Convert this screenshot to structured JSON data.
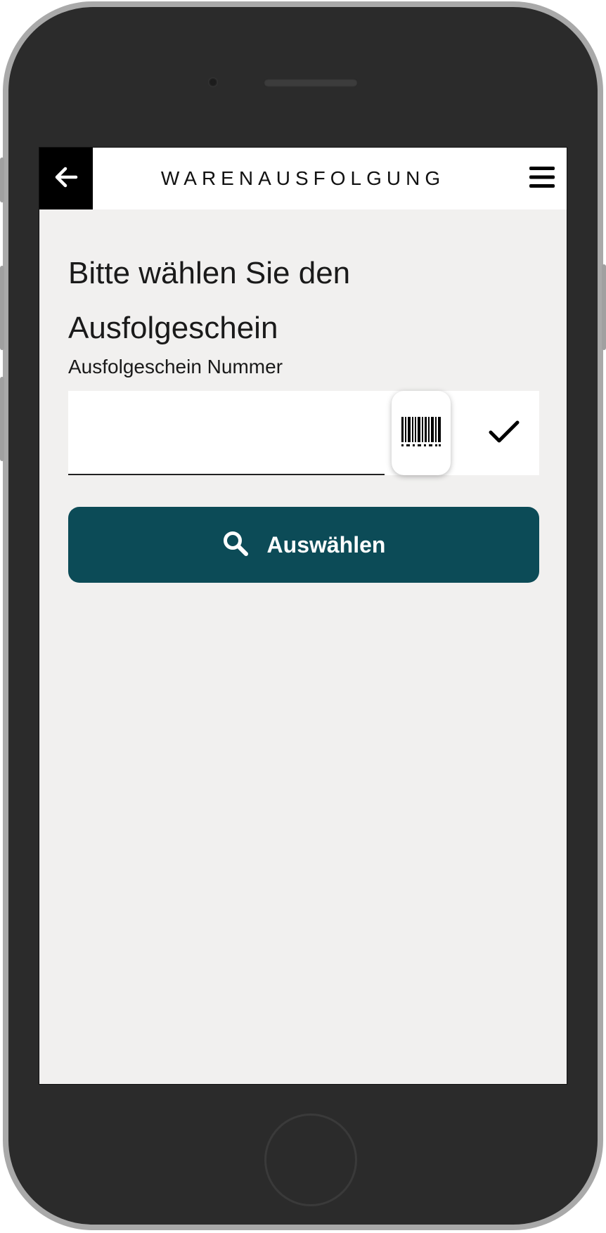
{
  "header": {
    "title": "WARENAUSFOLGUNG",
    "back_icon": "arrow-left-icon",
    "menu_icon": "hamburger-menu-icon"
  },
  "main": {
    "heading": "Bitte wählen Sie den Ausfolgeschein",
    "field_label": "Ausfolgeschein Nummer",
    "field_value": "",
    "scan_icon": "barcode-icon",
    "confirm_icon": "checkmark-icon",
    "select_button_label": "Auswählen",
    "select_button_icon": "search-icon"
  },
  "colors": {
    "screen_background": "#f1f0ef",
    "primary_button": "#0c4b57",
    "header_background": "#ffffff",
    "back_button_background": "#000000"
  }
}
